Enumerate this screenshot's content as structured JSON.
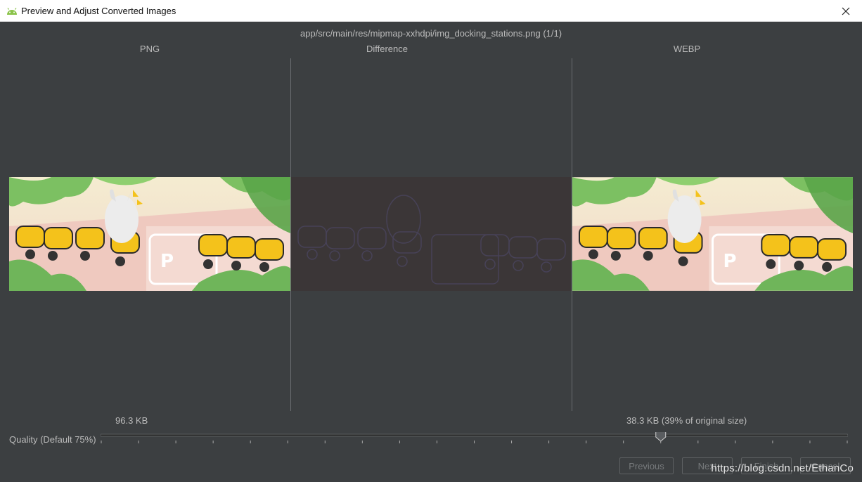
{
  "window": {
    "title": "Preview and Adjust Converted Images",
    "close_glyph": "✕"
  },
  "preview": {
    "file_path": "app/src/main/res/mipmap-xxhdpi/img_docking_stations.png (1/1)",
    "columns": {
      "left": "PNG",
      "middle": "Difference",
      "right": "WEBP"
    },
    "png_size": "96.3 KB",
    "webp_size": "38.3 KB (39% of original size)"
  },
  "quality": {
    "label": "Quality (Default 75%)",
    "value": 75,
    "min": 0,
    "max": 100
  },
  "buttons": {
    "previous": "Previous",
    "next": "Next",
    "finish": "Finish",
    "cancel": "Cancel"
  },
  "watermark": "https://blog.csdn.net/EthanCo",
  "colors": {
    "background": "#3c3f41",
    "text": "#bbbbbb",
    "accent_yellow": "#f4c21b",
    "foliage_green": "#6fb55a"
  },
  "icons": {
    "app": "android-icon",
    "close": "close-icon"
  }
}
